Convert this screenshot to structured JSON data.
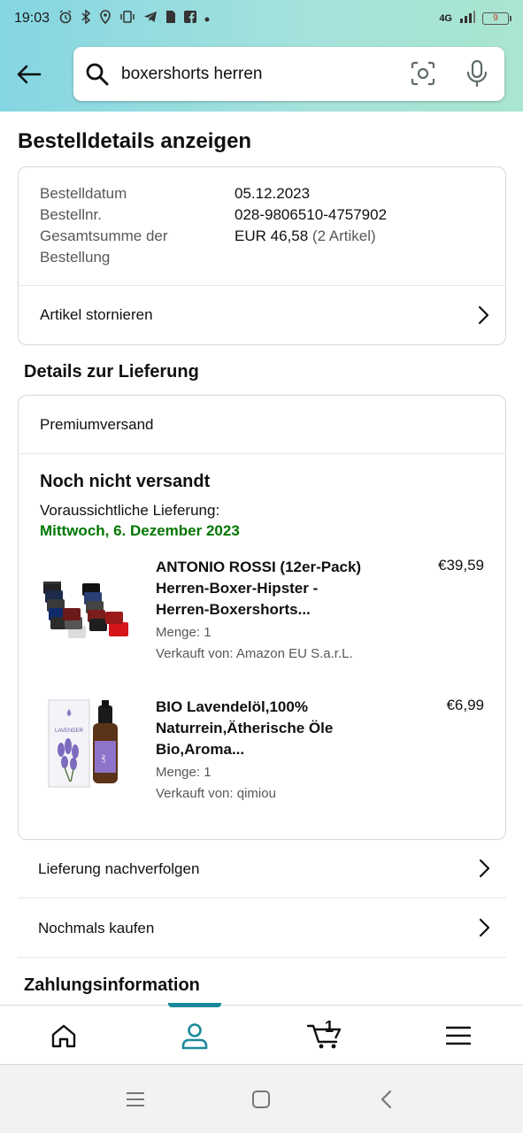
{
  "status_bar": {
    "time": "19:03",
    "network": "4G",
    "battery": "9"
  },
  "search": {
    "value": "boxershorts herren",
    "placeholder": ""
  },
  "page": {
    "title": "Bestelldetails anzeigen"
  },
  "order": {
    "date_label": "Bestelldatum",
    "date_value": "05.12.2023",
    "number_label": "Bestellnr.",
    "number_value": "028-9806510-4757902",
    "total_label_line1": "Gesamtsumme der",
    "total_label_line2": "Bestellung",
    "total_value": "EUR 46,58",
    "total_count": "(2 Artikel)",
    "cancel_label": "Artikel stornieren"
  },
  "delivery": {
    "section_title": "Details zur Lieferung",
    "shipping_type": "Premiumversand",
    "status": "Noch nicht versandt",
    "expected_label": "Voraussichtliche Lieferung:",
    "expected_date": "Mittwoch, 6. Dezember 2023",
    "items": [
      {
        "title_line1": "ANTONIO ROSSI (12er-Pack)",
        "title_line2": "Herren-Boxer-Hipster -",
        "title_line3": "Herren-Boxershorts...",
        "price": "€39,59",
        "quantity": "Menge: 1",
        "seller": "Verkauft von: Amazon EU S.a.r.L."
      },
      {
        "title_line1": "BIO Lavendelöl,100%",
        "title_line2": "Naturrein,Ätherische Öle",
        "title_line3": "Bio,Aroma...",
        "price": "€6,99",
        "quantity": "Menge: 1",
        "seller": "Verkauft von: qimiou",
        "box_label": "LAVENDER"
      }
    ],
    "track_label": "Lieferung nachverfolgen",
    "buy_again_label": "Nochmals kaufen"
  },
  "payment": {
    "section_title": "Zahlungsinformation"
  },
  "bottom_nav": {
    "cart_count": "1"
  },
  "colors": {
    "accent": "#1a8a9a",
    "delivery_green": "#007600",
    "header_gradient_start": "#84d6e2",
    "header_gradient_end": "#a9e5cf"
  }
}
